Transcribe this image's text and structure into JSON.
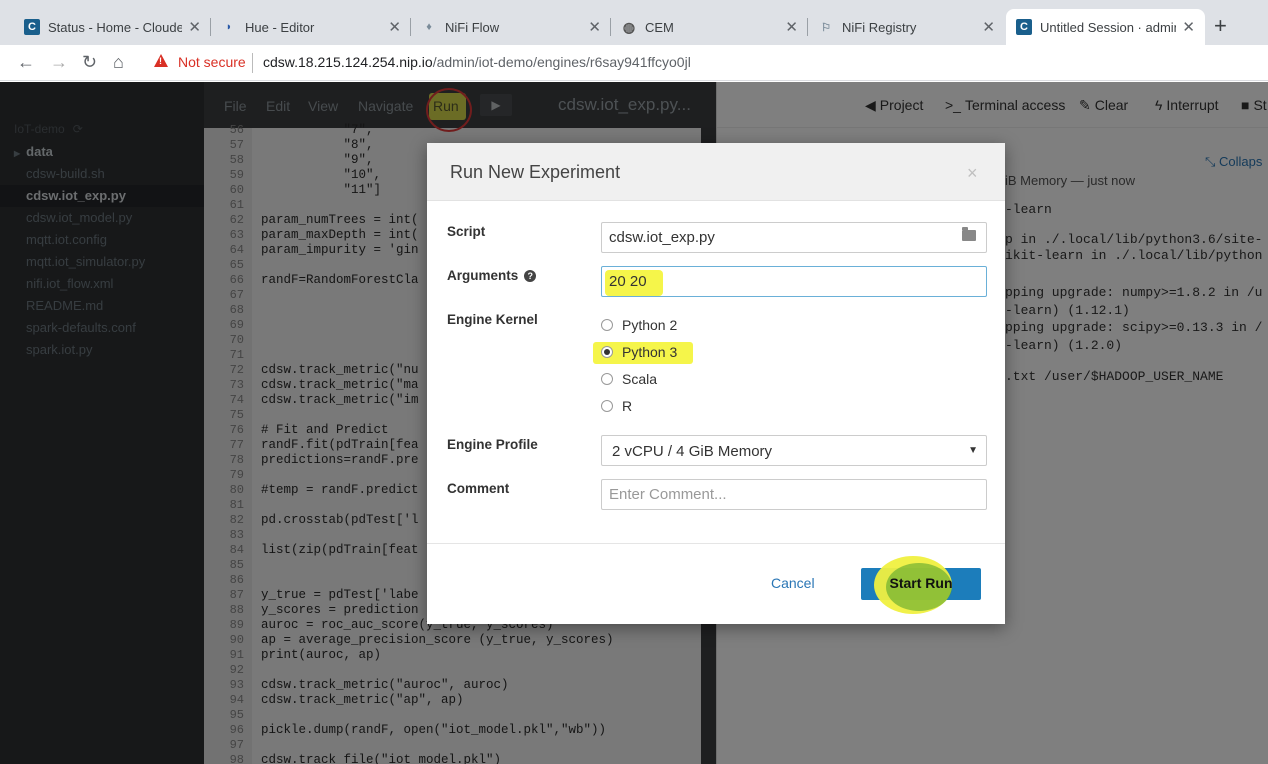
{
  "browser": {
    "tabs": [
      {
        "title": "Status - Home - Cloudera",
        "favicon": "C",
        "favicon_color": "#1a5f8c"
      },
      {
        "title": "Hue - Editor",
        "favicon": "H",
        "favicon_color": "#2a5aa8"
      },
      {
        "title": "NiFi Flow",
        "favicon": "N",
        "favicon_color": "#7a8b99"
      },
      {
        "title": "CEM",
        "favicon": "globe",
        "favicon_color": "#555555"
      },
      {
        "title": "NiFi Registry",
        "favicon": "R",
        "favicon_color": "#7a8b99"
      },
      {
        "title": "Untitled Session · admin",
        "favicon": "C",
        "favicon_color": "#1a5f8c"
      }
    ],
    "new_tab": "+",
    "security_label": "Not secure",
    "url_host": "cdsw.18.215.124.254.nip.io",
    "url_path": "/admin/iot-demo/engines/r6say941ffcyo0jl"
  },
  "sidebar": {
    "project": "IoT-demo",
    "files": [
      {
        "name": "data",
        "type": "folder"
      },
      {
        "name": "cdsw-build.sh",
        "type": "file"
      },
      {
        "name": "cdsw.iot_exp.py",
        "type": "file",
        "selected": true
      },
      {
        "name": "cdsw.iot_model.py",
        "type": "file"
      },
      {
        "name": "mqtt.iot.config",
        "type": "file"
      },
      {
        "name": "mqtt.iot_simulator.py",
        "type": "file"
      },
      {
        "name": "nifi.iot_flow.xml",
        "type": "file"
      },
      {
        "name": "README.md",
        "type": "file"
      },
      {
        "name": "spark-defaults.conf",
        "type": "file"
      },
      {
        "name": "spark.iot.py",
        "type": "file"
      }
    ]
  },
  "editor": {
    "menu": {
      "file": "File",
      "edit": "Edit",
      "view": "View",
      "navigate": "Navigate",
      "run": "Run"
    },
    "filename": "cdsw.iot_exp.py...",
    "lines": [
      {
        "n": "56",
        "code": "           \"7\","
      },
      {
        "n": "57",
        "code": "           \"8\","
      },
      {
        "n": "58",
        "code": "           \"9\","
      },
      {
        "n": "59",
        "code": "           \"10\","
      },
      {
        "n": "60",
        "code": "           \"11\"]"
      },
      {
        "n": "61",
        "code": ""
      },
      {
        "n": "62",
        "code": "param_numTrees = int("
      },
      {
        "n": "63",
        "code": "param_maxDepth = int("
      },
      {
        "n": "64",
        "code": "param_impurity = 'gin"
      },
      {
        "n": "65",
        "code": ""
      },
      {
        "n": "66",
        "code": "randF=RandomForestCla"
      },
      {
        "n": "67",
        "code": ""
      },
      {
        "n": "68",
        "code": ""
      },
      {
        "n": "69",
        "code": ""
      },
      {
        "n": "70",
        "code": ""
      },
      {
        "n": "71",
        "code": ""
      },
      {
        "n": "72",
        "code": "cdsw.track_metric(\"nu"
      },
      {
        "n": "73",
        "code": "cdsw.track_metric(\"ma"
      },
      {
        "n": "74",
        "code": "cdsw.track_metric(\"im"
      },
      {
        "n": "75",
        "code": ""
      },
      {
        "n": "76",
        "code": "# Fit and Predict"
      },
      {
        "n": "77",
        "code": "randF.fit(pdTrain[fea"
      },
      {
        "n": "78",
        "code": "predictions=randF.pre"
      },
      {
        "n": "79",
        "code": ""
      },
      {
        "n": "80",
        "code": "#temp = randF.predict"
      },
      {
        "n": "81",
        "code": ""
      },
      {
        "n": "82",
        "code": "pd.crosstab(pdTest['l"
      },
      {
        "n": "83",
        "code": ""
      },
      {
        "n": "84",
        "code": "list(zip(pdTrain[feat"
      },
      {
        "n": "85",
        "code": ""
      },
      {
        "n": "86",
        "code": ""
      },
      {
        "n": "87",
        "code": "y_true = pdTest['labe"
      },
      {
        "n": "88",
        "code": "y_scores = prediction"
      },
      {
        "n": "89",
        "code": "auroc = roc_auc_score(y_true, y_scores)"
      },
      {
        "n": "90",
        "code": "ap = average_precision_score (y_true, y_scores)"
      },
      {
        "n": "91",
        "code": "print(auroc, ap)"
      },
      {
        "n": "92",
        "code": ""
      },
      {
        "n": "93",
        "code": "cdsw.track_metric(\"auroc\", auroc)"
      },
      {
        "n": "94",
        "code": "cdsw.track_metric(\"ap\", ap)"
      },
      {
        "n": "95",
        "code": ""
      },
      {
        "n": "96",
        "code": "pickle.dump(randF, open(\"iot_model.pkl\",\"wb\"))"
      },
      {
        "n": "97",
        "code": ""
      },
      {
        "n": "98",
        "code": "cdsw.track_file(\"iot_model.pkl\")"
      }
    ]
  },
  "session": {
    "toolbar": {
      "project": "Project",
      "terminal": "Terminal access",
      "clear": "Clear",
      "interrupt": "Interrupt",
      "stop": "St"
    },
    "collapse": "Collaps",
    "output": [
      "iB Memory — just now",
      "-learn",
      "p in ./.local/lib/python3.6/site-",
      "ikit-learn in ./.local/lib/python",
      "pping upgrade: numpy>=1.8.2 in /u",
      "-learn) (1.12.1)",
      "pping upgrade: scipy>=0.13.3 in /",
      "-learn) (1.2.0)",
      ".txt /user/$HADOOP_USER_NAME"
    ]
  },
  "modal": {
    "title": "Run New Experiment",
    "close": "×",
    "script_label": "Script",
    "script_value": "cdsw.iot_exp.py",
    "arguments_label": "Arguments",
    "arguments_value": "20 20",
    "kernel_label": "Engine Kernel",
    "kernels": [
      {
        "label": "Python 2",
        "checked": false
      },
      {
        "label": "Python 3",
        "checked": true
      },
      {
        "label": "Scala",
        "checked": false
      },
      {
        "label": "R",
        "checked": false
      }
    ],
    "profile_label": "Engine Profile",
    "profile_value": "2 vCPU / 4 GiB Memory",
    "comment_label": "Comment",
    "comment_placeholder": "Enter Comment...",
    "cancel": "Cancel",
    "start_run": "Start Run"
  }
}
